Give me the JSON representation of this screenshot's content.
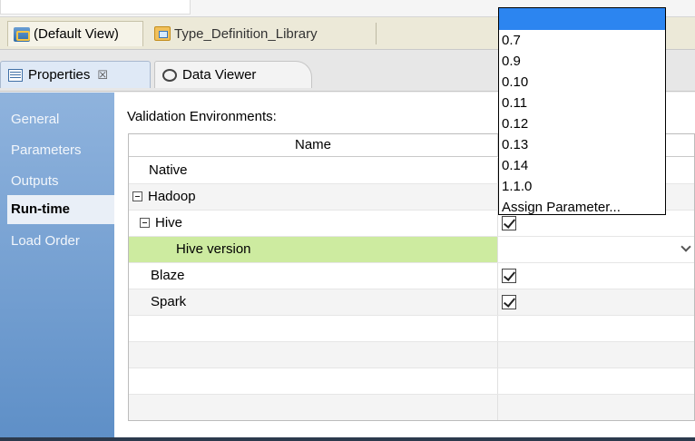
{
  "editor_tabs": [
    {
      "label": "(Default View)",
      "icon": "views-icon"
    },
    {
      "label": "Type_Definition_Library",
      "icon": "folder-icon"
    }
  ],
  "view_tabs": [
    {
      "label": "Properties",
      "close": "☒"
    },
    {
      "label": "Data Viewer"
    }
  ],
  "nav": {
    "items": [
      "General",
      "Parameters",
      "Outputs",
      "Run-time",
      "Load Order"
    ],
    "selected": "Run-time"
  },
  "content": {
    "section_label": "Validation Environments:",
    "column_name": "Name",
    "rows": [
      {
        "label": "Native",
        "checked": false
      },
      {
        "label": "Hadoop",
        "expanded": true
      },
      {
        "label": "Hive",
        "expanded": true,
        "checked": true
      },
      {
        "label": "Hive version",
        "highlighted": true,
        "dropdown": true
      },
      {
        "label": "Blaze",
        "checked": true
      },
      {
        "label": "Spark",
        "checked": true
      }
    ]
  },
  "dropdown": {
    "options": [
      "",
      "0.7",
      "0.9",
      "0.10",
      "0.11",
      "0.12",
      "0.13",
      "0.14",
      "1.1.0",
      "Assign Parameter..."
    ],
    "selected_index": 0,
    "highlight_color": "#2c85f0"
  }
}
